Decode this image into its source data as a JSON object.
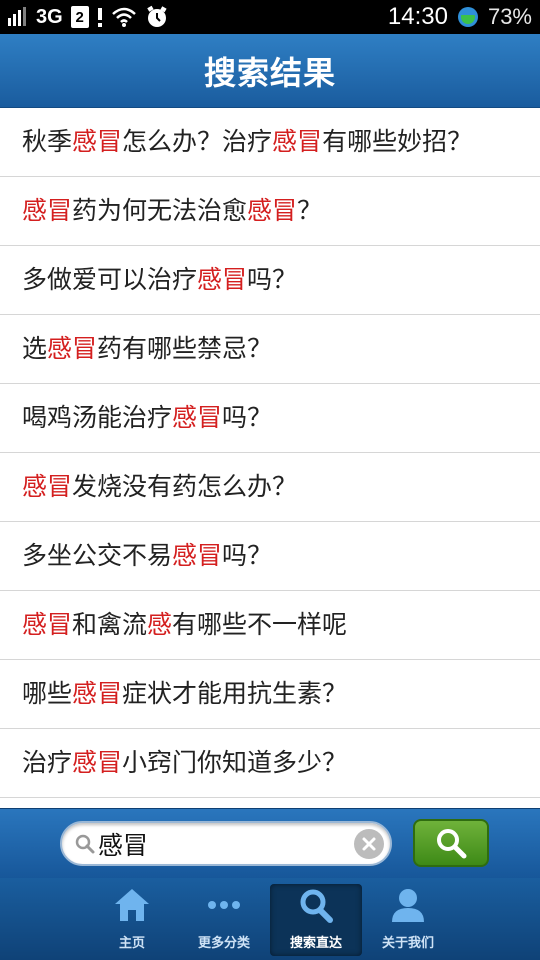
{
  "status_bar": {
    "network": "3G",
    "sim": "2",
    "time": "14:30",
    "battery": "73%"
  },
  "header": {
    "title": "搜索结果"
  },
  "results": [
    [
      {
        "t": "秋季",
        "h": false
      },
      {
        "t": "感冒",
        "h": true
      },
      {
        "t": "怎么办？治疗",
        "h": false
      },
      {
        "t": "感冒",
        "h": true
      },
      {
        "t": "有哪些妙招？",
        "h": false
      }
    ],
    [
      {
        "t": "感冒",
        "h": true
      },
      {
        "t": "药为何无法治愈",
        "h": false
      },
      {
        "t": "感冒",
        "h": true
      },
      {
        "t": "？",
        "h": false
      }
    ],
    [
      {
        "t": "多做爱可以治疗",
        "h": false
      },
      {
        "t": "感冒",
        "h": true
      },
      {
        "t": "吗？",
        "h": false
      }
    ],
    [
      {
        "t": "选",
        "h": false
      },
      {
        "t": "感冒",
        "h": true
      },
      {
        "t": "药有哪些禁忌？",
        "h": false
      }
    ],
    [
      {
        "t": "喝鸡汤能治疗",
        "h": false
      },
      {
        "t": "感冒",
        "h": true
      },
      {
        "t": "吗？",
        "h": false
      }
    ],
    [
      {
        "t": "感冒",
        "h": true
      },
      {
        "t": "发烧没有药怎么办？",
        "h": false
      }
    ],
    [
      {
        "t": "多坐公交不易",
        "h": false
      },
      {
        "t": "感冒",
        "h": true
      },
      {
        "t": "吗？",
        "h": false
      }
    ],
    [
      {
        "t": "感冒",
        "h": true
      },
      {
        "t": "和禽流",
        "h": false
      },
      {
        "t": "感",
        "h": true
      },
      {
        "t": "有哪些不一样呢",
        "h": false
      }
    ],
    [
      {
        "t": "哪些",
        "h": false
      },
      {
        "t": "感冒",
        "h": true
      },
      {
        "t": "症状才能用抗生素？",
        "h": false
      }
    ],
    [
      {
        "t": "治疗",
        "h": false
      },
      {
        "t": "感冒",
        "h": true
      },
      {
        "t": "小窍门你知道多少？",
        "h": false
      }
    ]
  ],
  "search": {
    "value": "感冒",
    "clear_icon": "close-icon",
    "search_icon": "search-icon"
  },
  "nav": {
    "items": [
      {
        "label": "主页",
        "icon": "home-icon"
      },
      {
        "label": "更多分类",
        "icon": "more-icon"
      },
      {
        "label": "搜索直达",
        "icon": "search-icon",
        "active": true
      },
      {
        "label": "关于我们",
        "icon": "user-icon"
      }
    ]
  },
  "colors": {
    "highlight": "#d41f1f",
    "header": "#1f68ae",
    "search_button": "#4f9a22"
  }
}
